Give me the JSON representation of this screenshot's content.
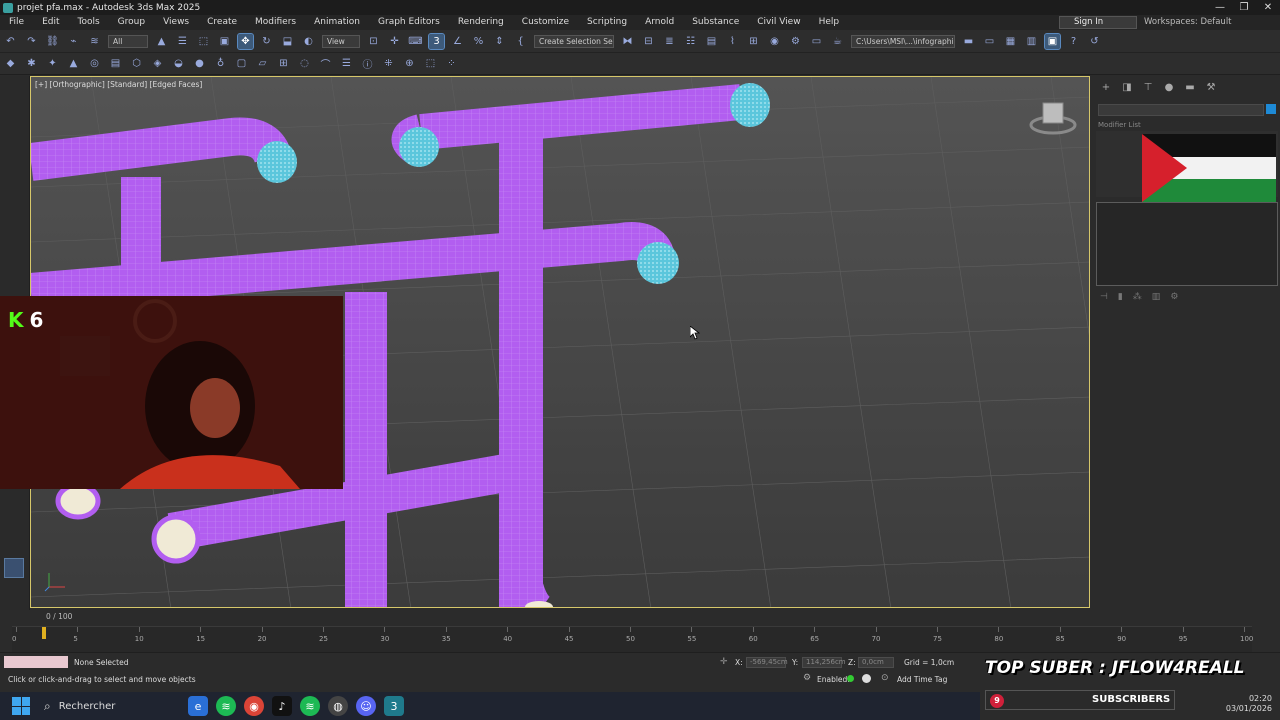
{
  "window": {
    "title": "projet pfa.max - Autodesk 3ds Max 2025",
    "controls": [
      "—",
      "❐",
      "✕"
    ]
  },
  "menu": {
    "items": [
      "File",
      "Edit",
      "Tools",
      "Group",
      "Views",
      "Create",
      "Modifiers",
      "Animation",
      "Graph Editors",
      "Rendering",
      "Customize",
      "Scripting",
      "Arnold",
      "Substance",
      "Civil View",
      "Help"
    ],
    "sign_in": "Sign In",
    "workspaces": "Workspaces: Default"
  },
  "toolbar": {
    "filter_value": "All",
    "view_value": "View",
    "selection_set_placeholder": "Create Selection Se",
    "path_value": "C:\\Users\\MSI\\...\\infographie"
  },
  "viewport": {
    "label": "[+] [Orthographic] [Standard] [Edged Faces]",
    "pipe_color": "#b25ef0",
    "pipe_end_color": "#5bc6dc"
  },
  "webcam": {
    "kick_badge": "K",
    "viewer_count": "6"
  },
  "command_panel": {
    "modifier_list_label": "Modifier List"
  },
  "timeline": {
    "frame_counter": "0 / 100",
    "ticks": [
      "0",
      "5",
      "10",
      "15",
      "20",
      "25",
      "30",
      "35",
      "40",
      "45",
      "50",
      "55",
      "60",
      "65",
      "70",
      "75",
      "80",
      "85",
      "90",
      "95",
      "100"
    ]
  },
  "status": {
    "selection": "None Selected",
    "prompt": "Click or click-and-drag to select and move objects",
    "x_label": "X:",
    "x_value": "-569,45cm",
    "y_label": "Y:",
    "y_value": "114,256cm",
    "z_label": "Z:",
    "z_value": "0,0cm",
    "grid": "Grid = 1,0cm",
    "enabled": "Enabled:",
    "add_time_tag": "Add Time Tag"
  },
  "overlay": {
    "top_suber": "TOP SUBER : JFLOW4REALL",
    "subscriber_count": "9",
    "subscriber_label": "SUBSCRIBERS"
  },
  "taskbar": {
    "search_label": "Rechercher",
    "time": "02:20",
    "date": "03/01/2026"
  }
}
